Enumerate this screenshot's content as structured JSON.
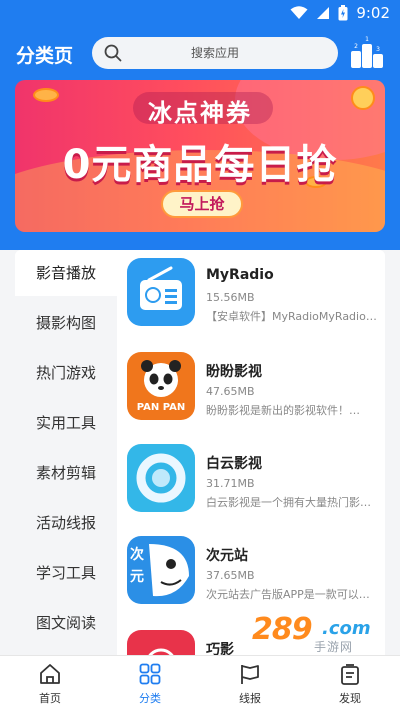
{
  "status_bar": {
    "time": "9:02"
  },
  "header": {
    "title": "分类页",
    "search_placeholder": "搜索应用",
    "search_icon": "search-icon",
    "rank_icon": "ranking-podium-icon"
  },
  "banner": {
    "subtitle": "冰点神券",
    "title": "0元商品每日抢",
    "button": "马上抢"
  },
  "sidebar": {
    "items": [
      {
        "label": "影音播放",
        "active": true
      },
      {
        "label": "摄影构图"
      },
      {
        "label": "热门游戏"
      },
      {
        "label": "实用工具"
      },
      {
        "label": "素材剪辑"
      },
      {
        "label": "活动线报"
      },
      {
        "label": "学习工具"
      },
      {
        "label": "图文阅读"
      }
    ]
  },
  "apps": [
    {
      "name": "MyRadio",
      "size": "15.56MB",
      "desc": "【安卓软件】MyRadioMyRadio收音机",
      "icon": "radio-icon"
    },
    {
      "name": "盼盼影视",
      "size": "47.65MB",
      "desc": "盼盼影视是新出的影视软件！…",
      "icon": "panda-icon",
      "icon_text": "PAN PAN"
    },
    {
      "name": "白云影视",
      "size": "31.71MB",
      "desc": "白云影视是一个拥有大量热门影视资源",
      "icon": "cloud-icon"
    },
    {
      "name": "次元站",
      "size": "37.65MB",
      "desc": "次元站去广告版APP是一款可以看动漫",
      "icon": "anime-fish-icon",
      "icon_text": "次元"
    },
    {
      "name": "巧影",
      "size": "",
      "desc": "",
      "icon": "kinemaster-icon"
    }
  ],
  "watermark": {
    "num": "289",
    "com": ".com",
    "sub": "手游网"
  },
  "bottom_nav": [
    {
      "label": "首页",
      "icon": "home-icon"
    },
    {
      "label": "分类",
      "icon": "category-grid-icon",
      "active": true
    },
    {
      "label": "线报",
      "icon": "flag-icon"
    },
    {
      "label": "发现",
      "icon": "discover-icon"
    }
  ],
  "colors": {
    "primary": "#1f7df0",
    "banner_pink": "#f0346b",
    "banner_orange": "#ff7a4a"
  }
}
